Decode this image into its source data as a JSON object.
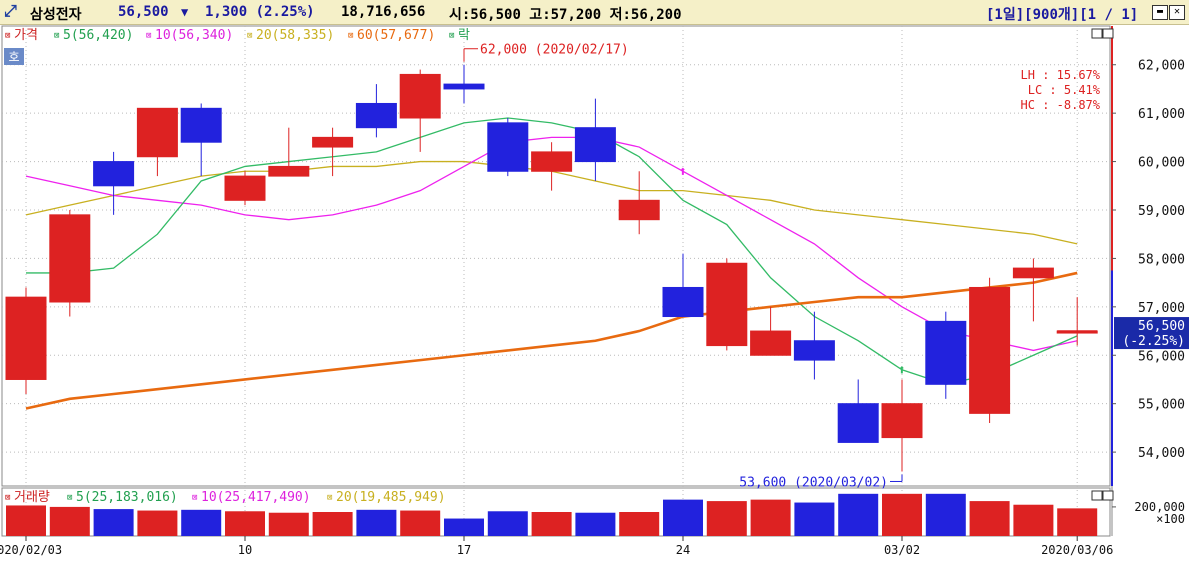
{
  "header": {
    "name": "삼성전자",
    "price": "56,500",
    "arrow": "▼",
    "change": "1,300 (2.25%)",
    "volume": "18,716,656",
    "ohlc": "시:56,500 고:57,200 저:56,200",
    "page_info": "[1일][900개][1 / 1]"
  },
  "price_legend": [
    {
      "label": "가격",
      "color": "#cc2222"
    },
    {
      "label": "5(56,420)",
      "color": "#22a050"
    },
    {
      "label": "10(56,340)",
      "color": "#dd22dd"
    },
    {
      "label": "20(58,335)",
      "color": "#c8b020"
    },
    {
      "label": "60(57,677)",
      "color": "#e86a10"
    },
    {
      "label": "락",
      "color": "#22a050"
    }
  ],
  "ho_badge": "호",
  "stats": [
    "LH : 15.67%",
    "LC :  5.41%",
    "HC : -8.87%"
  ],
  "annotations": {
    "high": "62,000 (2020/02/17)",
    "low": "53,600 (2020/03/02)"
  },
  "current_price_label": [
    "56,500",
    "(-2.25%)"
  ],
  "volume_legend": [
    {
      "label": "거래량",
      "color": "#cc2222"
    },
    {
      "label": "5(25,183,016)",
      "color": "#22a050"
    },
    {
      "label": "10(25,417,490)",
      "color": "#dd22dd"
    },
    {
      "label": "20(19,485,949)",
      "color": "#c8b020"
    }
  ],
  "volume_axis": {
    "tick": "200,000",
    "unit": "×100"
  },
  "colors": {
    "up": "#dd2222",
    "down": "#2222dd",
    "ma5": "#33bb66",
    "ma10": "#ee22ee",
    "ma20": "#c8b020",
    "ma60": "#e86a10"
  },
  "chart_data": {
    "type": "candlestick",
    "price_axis": {
      "min": 53300,
      "max": 62800,
      "ticks": [
        54000,
        55000,
        56000,
        57000,
        58000,
        59000,
        60000,
        61000,
        62000
      ],
      "tick_labels": [
        "54,000",
        "55,000",
        "56,000",
        "57,000",
        "58,000",
        "59,000",
        "60,000",
        "61,000",
        "62,000"
      ]
    },
    "x_labels": [
      {
        "label": "2020/02/03",
        "index": 0
      },
      {
        "label": "10",
        "index": 5
      },
      {
        "label": "17",
        "index": 10
      },
      {
        "label": "24",
        "index": 15
      },
      {
        "label": "03/02",
        "index": 20
      },
      {
        "label": "2020/03/06",
        "index": 24
      }
    ],
    "candles": [
      {
        "date": "2020/02/03",
        "open": 55500,
        "high": 57400,
        "low": 55200,
        "close": 57200
      },
      {
        "date": "2020/02/04",
        "open": 57100,
        "high": 59000,
        "low": 56800,
        "close": 58900
      },
      {
        "date": "2020/02/05",
        "open": 60000,
        "high": 60200,
        "low": 58900,
        "close": 59500
      },
      {
        "date": "2020/02/06",
        "open": 60100,
        "high": 61100,
        "low": 59700,
        "close": 61100
      },
      {
        "date": "2020/02/07",
        "open": 61100,
        "high": 61200,
        "low": 59700,
        "close": 60400
      },
      {
        "date": "2020/02/10",
        "open": 59200,
        "high": 59800,
        "low": 59100,
        "close": 59700
      },
      {
        "date": "2020/02/11",
        "open": 59700,
        "high": 60700,
        "low": 59700,
        "close": 59900
      },
      {
        "date": "2020/02/12",
        "open": 60300,
        "high": 60700,
        "low": 59700,
        "close": 60500
      },
      {
        "date": "2020/02/13",
        "open": 61200,
        "high": 61600,
        "low": 60500,
        "close": 60700
      },
      {
        "date": "2020/02/14",
        "open": 60900,
        "high": 61900,
        "low": 60200,
        "close": 61800
      },
      {
        "date": "2020/02/17",
        "open": 61600,
        "high": 62000,
        "low": 61200,
        "close": 61500
      },
      {
        "date": "2020/02/18",
        "open": 60800,
        "high": 60900,
        "low": 59700,
        "close": 59800
      },
      {
        "date": "2020/02/19",
        "open": 59800,
        "high": 60400,
        "low": 59400,
        "close": 60200
      },
      {
        "date": "2020/02/20",
        "open": 60700,
        "high": 61300,
        "low": 59600,
        "close": 60000
      },
      {
        "date": "2020/02/21",
        "open": 58800,
        "high": 59800,
        "low": 58500,
        "close": 59200
      },
      {
        "date": "2020/02/24",
        "open": 57400,
        "high": 58100,
        "low": 56800,
        "close": 56800
      },
      {
        "date": "2020/02/25",
        "open": 56200,
        "high": 58000,
        "low": 56100,
        "close": 57900
      },
      {
        "date": "2020/02/26",
        "open": 56000,
        "high": 57000,
        "low": 56000,
        "close": 56500
      },
      {
        "date": "2020/02/27",
        "open": 56300,
        "high": 56900,
        "low": 55500,
        "close": 55900
      },
      {
        "date": "2020/02/28",
        "open": 55000,
        "high": 55500,
        "low": 54200,
        "close": 54200
      },
      {
        "date": "2020/03/02",
        "open": 54300,
        "high": 55500,
        "low": 53600,
        "close": 55000
      },
      {
        "date": "2020/03/03",
        "open": 56700,
        "high": 56900,
        "low": 55100,
        "close": 55400
      },
      {
        "date": "2020/03/04",
        "open": 54800,
        "high": 57600,
        "low": 54600,
        "close": 57400
      },
      {
        "date": "2020/03/05",
        "open": 57600,
        "high": 58000,
        "low": 56700,
        "close": 57800
      },
      {
        "date": "2020/03/06",
        "open": 56500,
        "high": 57200,
        "low": 56200,
        "close": 56500
      }
    ],
    "ma5": [
      57700,
      57700,
      57800,
      58500,
      59600,
      59900,
      60000,
      60100,
      60200,
      60500,
      60800,
      60900,
      60800,
      60600,
      60100,
      59200,
      58700,
      57600,
      56800,
      56300,
      55700,
      55400,
      55600,
      56000,
      56400
    ],
    "ma10": [
      59700,
      59500,
      59300,
      59200,
      59100,
      58900,
      58800,
      58900,
      59100,
      59400,
      59900,
      60400,
      60500,
      60500,
      60300,
      59800,
      59300,
      58800,
      58300,
      57600,
      57000,
      56500,
      56300,
      56100,
      56300
    ],
    "ma20": [
      58900,
      59100,
      59300,
      59500,
      59700,
      59800,
      59800,
      59900,
      59900,
      60000,
      60000,
      59900,
      59800,
      59600,
      59400,
      59400,
      59300,
      59200,
      59000,
      58900,
      58800,
      58700,
      58600,
      58500,
      58300
    ],
    "ma60": [
      54900,
      55100,
      55200,
      55300,
      55400,
      55500,
      55600,
      55700,
      55800,
      55900,
      56000,
      56100,
      56200,
      56300,
      56500,
      56800,
      56900,
      57000,
      57100,
      57200,
      57200,
      57300,
      57400,
      57500,
      57700
    ],
    "volume": {
      "tick": 200000,
      "bars": [
        {
          "value": 210000,
          "dir": "up"
        },
        {
          "value": 200000,
          "dir": "up"
        },
        {
          "value": 185000,
          "dir": "down"
        },
        {
          "value": 175000,
          "dir": "up"
        },
        {
          "value": 180000,
          "dir": "down"
        },
        {
          "value": 170000,
          "dir": "up"
        },
        {
          "value": 160000,
          "dir": "up"
        },
        {
          "value": 165000,
          "dir": "up"
        },
        {
          "value": 180000,
          "dir": "down"
        },
        {
          "value": 175000,
          "dir": "up"
        },
        {
          "value": 120000,
          "dir": "down"
        },
        {
          "value": 170000,
          "dir": "down"
        },
        {
          "value": 165000,
          "dir": "up"
        },
        {
          "value": 160000,
          "dir": "down"
        },
        {
          "value": 165000,
          "dir": "up"
        },
        {
          "value": 250000,
          "dir": "down"
        },
        {
          "value": 240000,
          "dir": "up"
        },
        {
          "value": 250000,
          "dir": "up"
        },
        {
          "value": 230000,
          "dir": "down"
        },
        {
          "value": 290000,
          "dir": "down"
        },
        {
          "value": 290000,
          "dir": "up"
        },
        {
          "value": 290000,
          "dir": "down"
        },
        {
          "value": 240000,
          "dir": "up"
        },
        {
          "value": 215000,
          "dir": "up"
        },
        {
          "value": 190000,
          "dir": "up"
        }
      ]
    }
  }
}
